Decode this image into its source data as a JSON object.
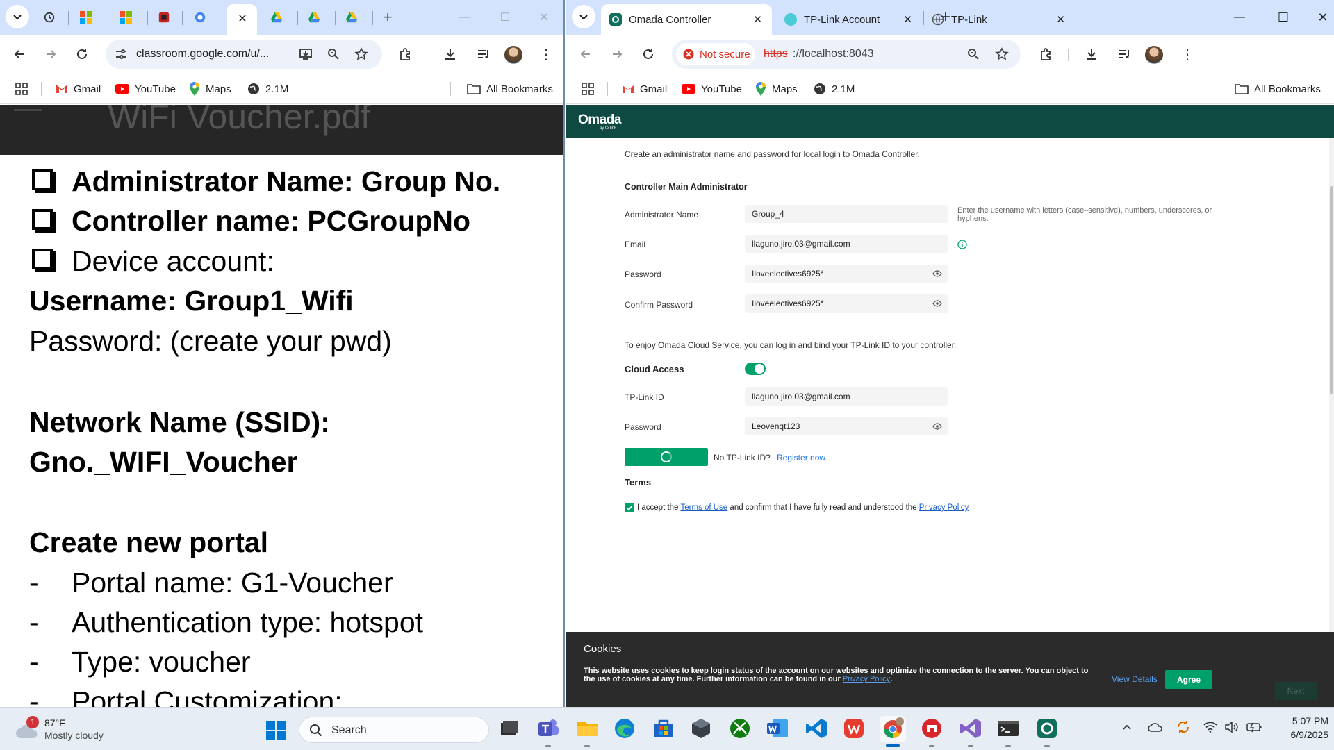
{
  "left_window": {
    "tabs": [
      {
        "name": "history-tab"
      },
      {
        "name": "microsoft-tab-1"
      },
      {
        "name": "microsoft-tab-2"
      },
      {
        "name": "red-app-tab"
      },
      {
        "name": "google-tab-active"
      },
      {
        "name": "drive-tab-1"
      },
      {
        "name": "drive-tab-2"
      },
      {
        "name": "drive-tab-3"
      }
    ],
    "url": "classroom.google.com/u/...",
    "bookmarks": {
      "gmail": "Gmail",
      "youtube": "YouTube",
      "maps": "Maps",
      "counter": "2.1M",
      "all": "All Bookmarks"
    },
    "doc_header_partial": "WiFi Voucher.pdf",
    "content": {
      "line1": "Administrator Name: Group No.",
      "line2": "Controller name: PCGroupNo",
      "line3": "Device account:",
      "line4": "Username: Group1_Wifi",
      "line5": "Password: (create your pwd)",
      "line6": "Network Name (SSID):",
      "line7": "Gno._WIFI_Voucher",
      "line8": "Create new portal",
      "bullet_char": "-",
      "bullet1": "Portal name: G1-Voucher",
      "bullet2": "Authentication type: hotspot",
      "bullet3": "Type: voucher",
      "bullet4": "Portal Customization:"
    }
  },
  "right_window": {
    "tabs": [
      {
        "label": "Omada Controller",
        "active": true
      },
      {
        "label": "TP-Link Account",
        "active": false
      },
      {
        "label": "TP-Link",
        "active": false
      }
    ],
    "security_chip": "Not secure",
    "url_scheme": "https",
    "url_rest": "://localhost:8043",
    "bookmarks": {
      "gmail": "Gmail",
      "youtube": "YouTube",
      "maps": "Maps",
      "counter": "2.1M",
      "all": "All Bookmarks"
    },
    "brand": {
      "logo": "Omada",
      "sub": "by tp-link",
      "header_color": "#0f4a42"
    },
    "form": {
      "intro": "Create an administrator name and password for local login to Omada Controller.",
      "section_title": "Controller Main Administrator",
      "admin_name_label": "Administrator Name",
      "admin_name_value": "Group_4",
      "admin_name_hint": "Enter the username with letters (case–sensitive), numbers, underscores, or hyphens.",
      "email_label": "Email",
      "email_value": "llaguno.jiro.03@gmail.com",
      "password_label": "Password",
      "password_value": "Iloveelectives6925*",
      "confirm_label": "Confirm Password",
      "confirm_value": "Iloveelectives6925*",
      "cloud_intro": "To enjoy Omada Cloud Service, you can log in and bind your TP-Link ID to your controller.",
      "cloud_access_label": "Cloud Access",
      "cloud_access_on": true,
      "tplink_id_label": "TP-Link ID",
      "tplink_id_value": "llaguno.jiro.03@gmail.com",
      "tp_password_label": "Password",
      "tp_password_value": "Leovenqt123",
      "no_id_text": "No TP-Link ID?",
      "register_link": "Register now.",
      "terms_title": "Terms",
      "terms_prefix": "I accept the",
      "terms_link": "Terms of Use",
      "terms_middle": "and confirm that I have fully read and understood the",
      "privacy_link": "Privacy Policy",
      "accent_color": "#00a06a"
    },
    "cookies": {
      "title": "Cookies",
      "text": "This website uses cookies to keep login status of the account on our websites and optimize the connection to the server. You can object to the use of cookies at any time. Further information can be found in our",
      "policy_link": "Privacy Policy",
      "period": ".",
      "view_details": "View Details",
      "agree": "Agree",
      "next": "Next"
    }
  },
  "taskbar": {
    "weather_temp": "87°F",
    "weather_desc": "Mostly cloudy",
    "weather_badge": "1",
    "search_placeholder": "Search",
    "time": "5:07 PM",
    "date": "6/9/2025",
    "apps": [
      "windows-start-icon",
      "file-viewer-icon",
      "teams-icon",
      "file-explorer-icon",
      "edge-icon",
      "store-icon",
      "cube-app-icon",
      "xbox-icon",
      "word-icon",
      "vscode-icon",
      "wps-icon",
      "chrome-icon",
      "red-circle-app-icon",
      "visual-studio-icon",
      "terminal-icon",
      "omada-app-icon"
    ]
  }
}
